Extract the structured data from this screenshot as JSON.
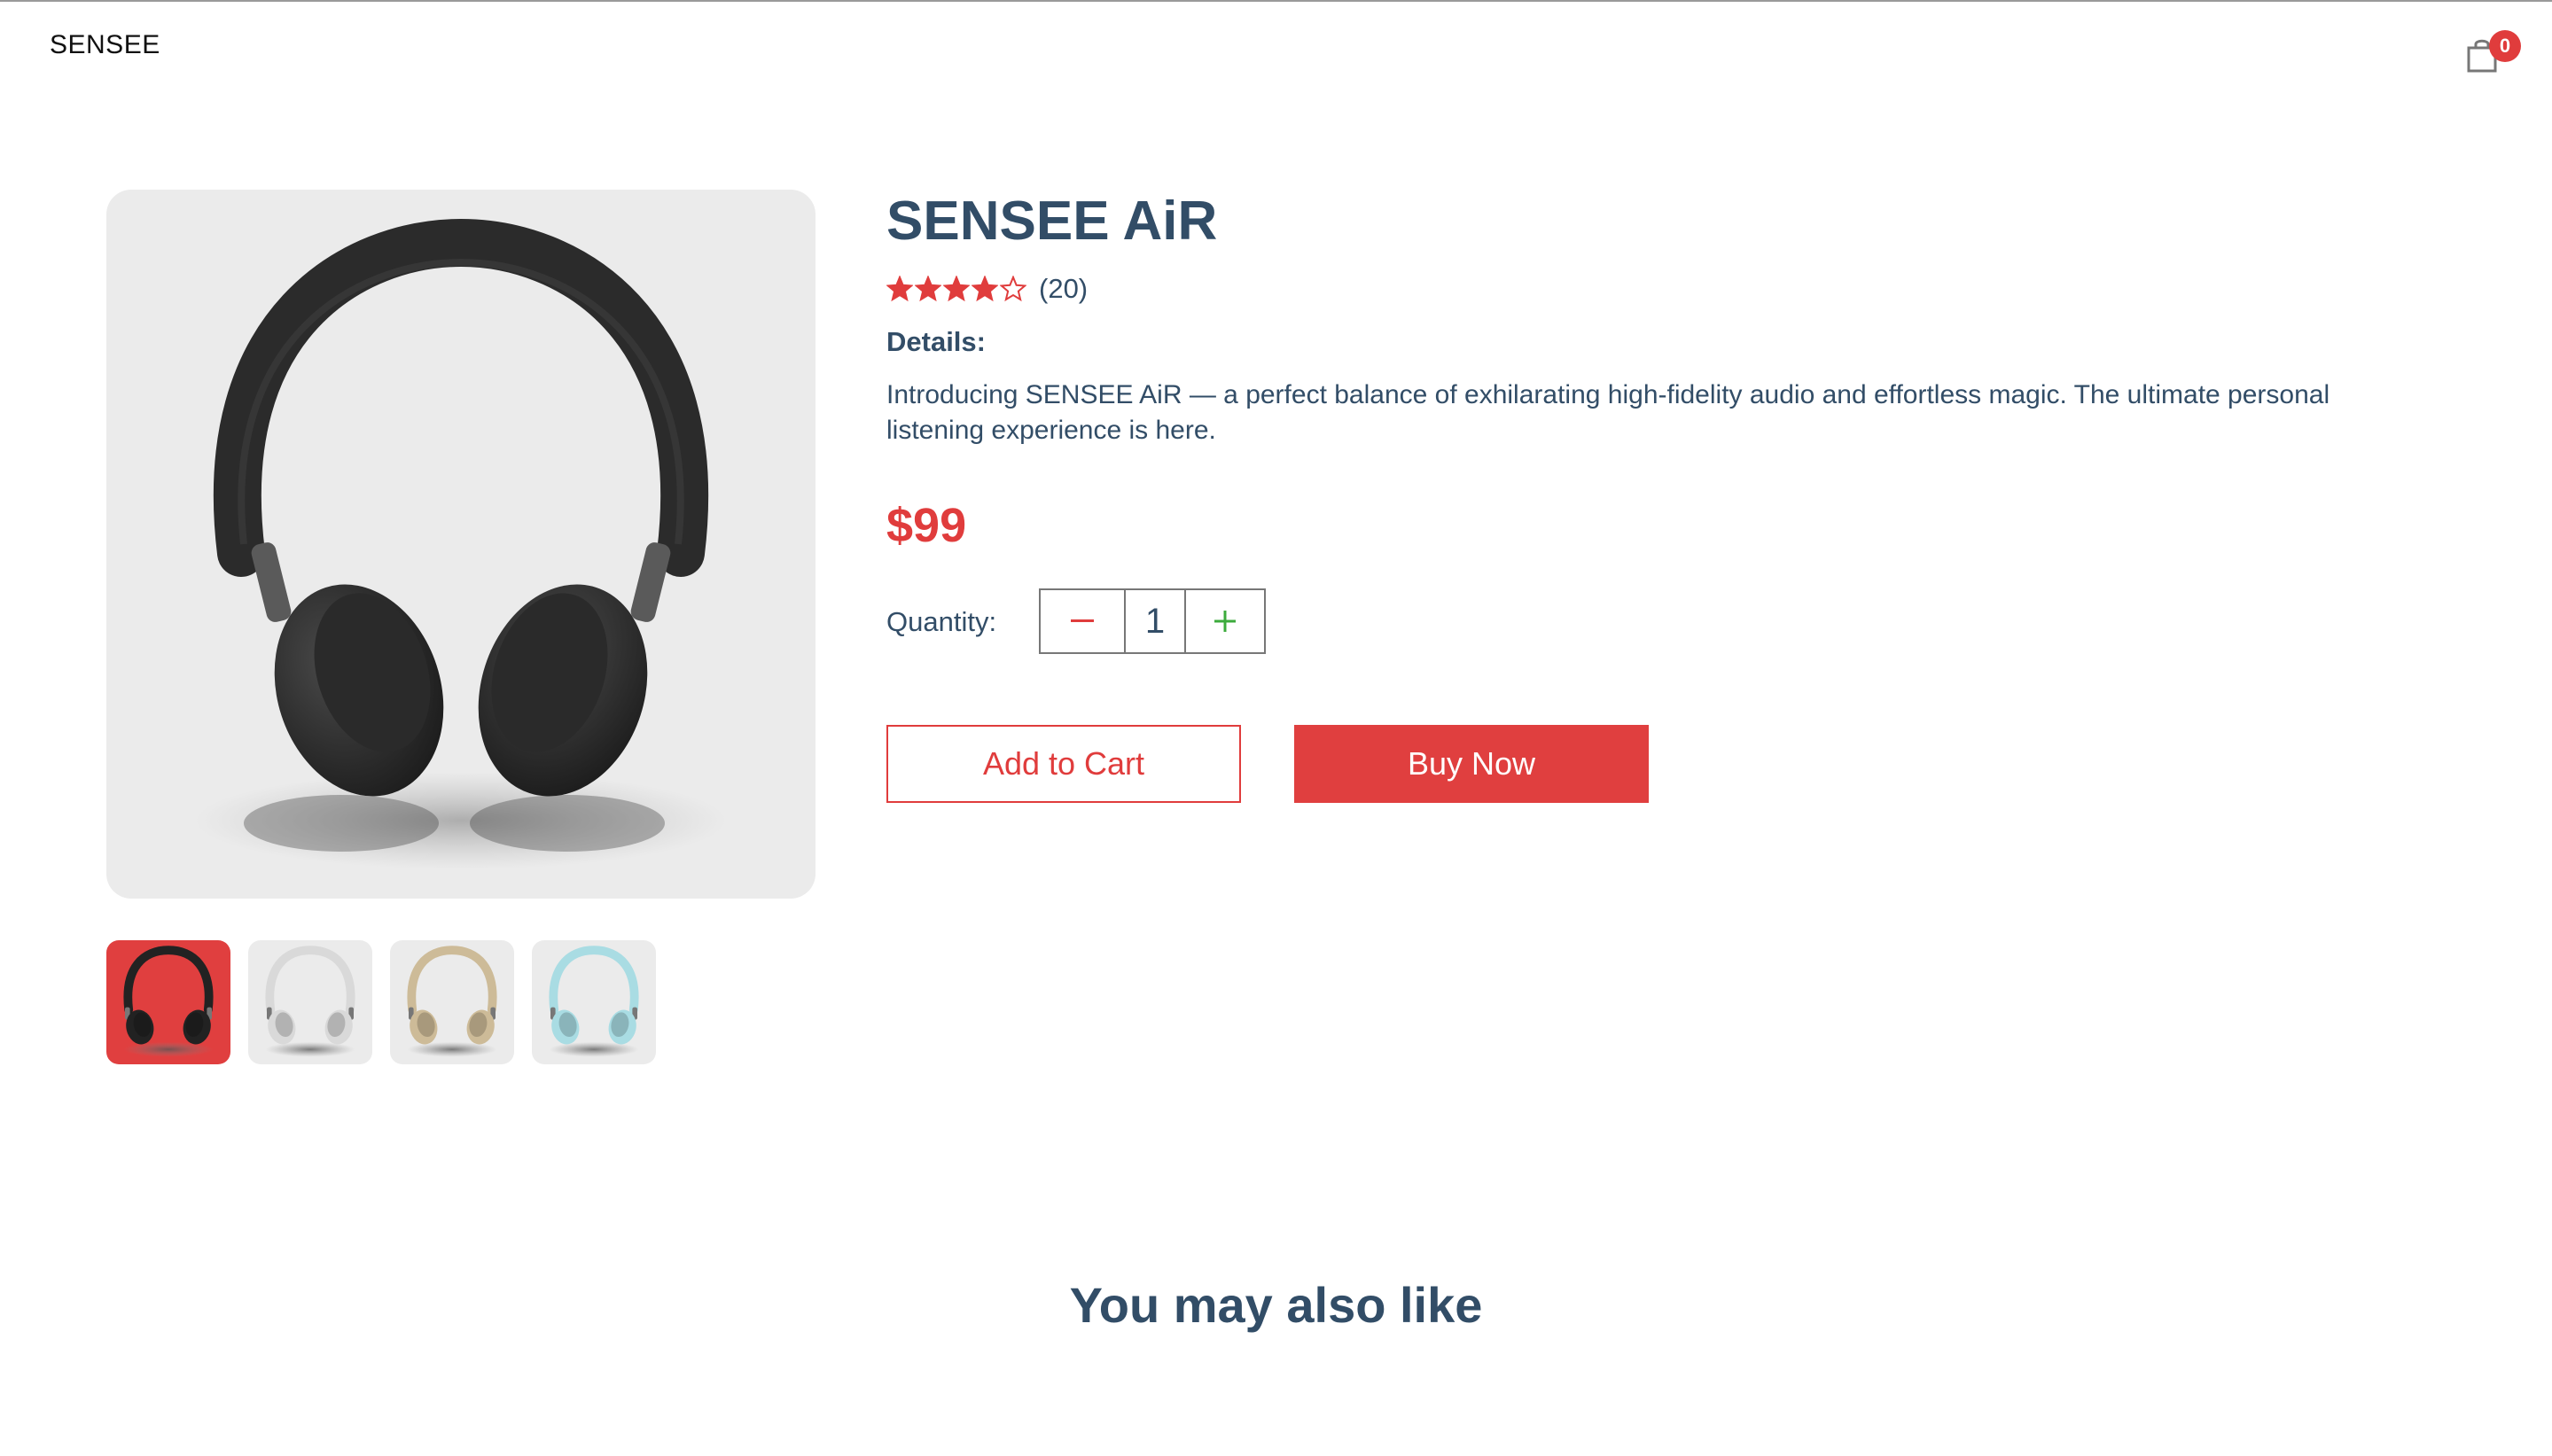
{
  "navbar": {
    "logo": "SENSEE",
    "cart_icon": "shopping-bag-icon",
    "cart_count": "0"
  },
  "product": {
    "title": "SENSEE AiR",
    "rating_value": 4,
    "rating_max": 5,
    "review_count": "(20)",
    "details_label": "Details:",
    "details_text": "Introducing SENSEE AiR — a perfect balance of exhilarating high-fidelity audio and effortless magic. The ultimate personal listening experience is here.",
    "price": "$99",
    "quantity_label": "Quantity:",
    "quantity_value": "1",
    "decrement_icon": "minus-icon",
    "increment_icon": "plus-icon",
    "add_to_cart_label": "Add to Cart",
    "buy_now_label": "Buy Now"
  },
  "gallery": {
    "main_image": "headphones-black",
    "thumbnails": [
      {
        "image": "headphones-black",
        "active": true
      },
      {
        "image": "headphones-white",
        "active": false
      },
      {
        "image": "headphones-beige",
        "active": false
      },
      {
        "image": "headphones-light-blue",
        "active": false
      }
    ]
  },
  "related": {
    "title": "You may also like"
  },
  "colors": {
    "accent": "#e03c3c",
    "text": "#324d67",
    "plus": "#3cab3c",
    "image_bg": "#ebebeb"
  }
}
